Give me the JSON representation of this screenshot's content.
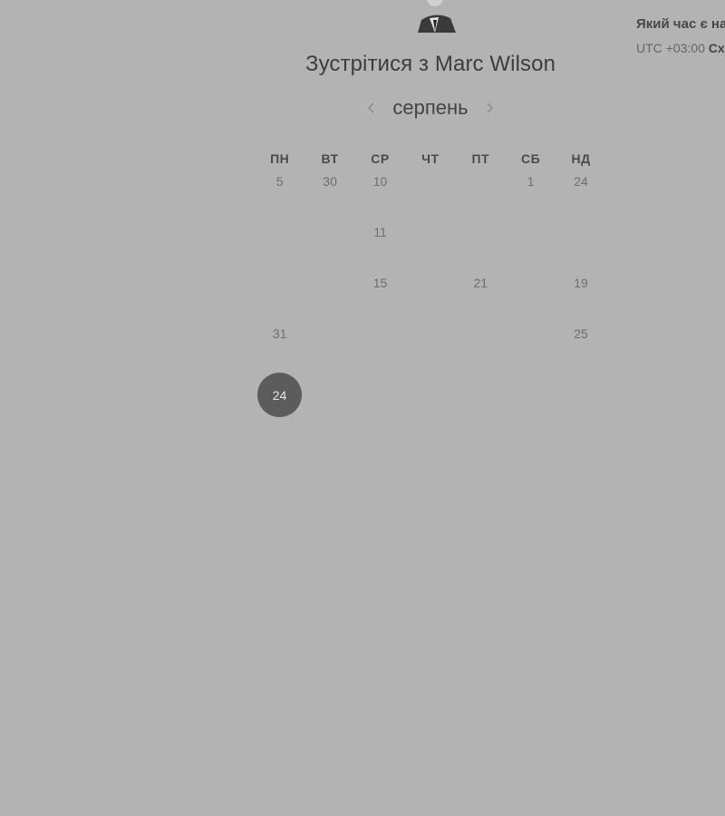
{
  "header": {
    "title": "Зустрітися з Marc Wilson"
  },
  "timezone": {
    "question": "Який час є на",
    "offset": "UTC +03:00",
    "name": "Сх"
  },
  "month_nav": {
    "month": "серпень",
    "prev_icon": "chevron-left-icon",
    "next_icon": "chevron-right-icon"
  },
  "calendar": {
    "weekdays": [
      "ПН",
      "ВТ",
      "СР",
      "ЧТ",
      "ПТ",
      "СБ",
      "НД"
    ],
    "rows": [
      [
        "5",
        "30",
        "10",
        "",
        "",
        "1",
        "24"
      ],
      [
        "",
        "",
        "11",
        "",
        "",
        "",
        ""
      ],
      [
        "",
        "",
        "15",
        "",
        "21",
        "",
        "19"
      ],
      [
        "31",
        "",
        "",
        "",
        "",
        "",
        "25"
      ],
      [
        "24",
        "",
        "",
        "",
        "",
        "",
        ""
      ]
    ],
    "selected": "24"
  },
  "colors": {
    "background": "#b3b3b3",
    "selected_fill": "#5c5c5c",
    "text": "#3d3d3d"
  }
}
